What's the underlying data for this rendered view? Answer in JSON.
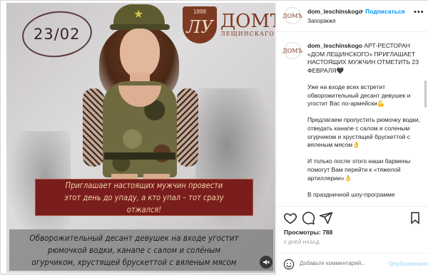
{
  "post_image": {
    "date": "23/02",
    "logo_year": "1898",
    "logo_monogram": "ЛУ",
    "logo_name": "ДОМЪ",
    "logo_subname": "ЛЕЩИНСКАГО",
    "red_banner_text": "Приглашает настоящих мужчин провести этот день до упаду, а кто упал – тот сразу отжался!",
    "gray_banner_text": "Обворожительный десант девушек на входе угостит рюмочкой водки, канапе с салом и солёным огурчиком, хрустящей брускеттой с вяленым мясом",
    "sound_icon": "mute-icon"
  },
  "header": {
    "username": "dom_leschinskogo",
    "dot": "•",
    "follow_label": "Подписаться",
    "location": "Запоріжжя",
    "more_label": "•••",
    "avatar_text": "ДОМЪ"
  },
  "caption": {
    "username": "dom_leschinskogo",
    "avatar_text": "ДОМЪ",
    "paragraphs": [
      "АРТ-РЕСТОРАН «ДОМ ЛЕЩИНСКОГО» ПРИГЛАШАЕТ НАСТОЯЩИХ МУЖЧИН ОТМЕТИТЬ 23 ФЕВРАЛЯ🖤",
      "Уже на входе всех встретит обворожительный десант девушек и угостит Вас по-армейски💪",
      "Предлагаем пропустить рюмочку водки, отведать канапе с салом и соленым огурчиком и хрустящей брускеттой с вяленым мясом👌",
      "И только после этого наши бармены помогут Вам перейти к «тяжелой артиллерии»👌",
      "В праздничной шоу-программе"
    ]
  },
  "actions": {
    "like_icon": "heart-icon",
    "comment_icon": "comment-icon",
    "share_icon": "share-icon",
    "save_icon": "bookmark-icon"
  },
  "stats": {
    "views": "Просмотры: 788",
    "time_ago": "2 ДНЕЙ НАЗАД"
  },
  "comment": {
    "placeholder": "Добавьте комментарий...",
    "publish_label": "Опубликовать"
  },
  "colors": {
    "accent": "#0095f6",
    "publish_disabled": "#b2dffc",
    "brand": "#7c3a23",
    "banner_red": "#7a1d1d"
  }
}
